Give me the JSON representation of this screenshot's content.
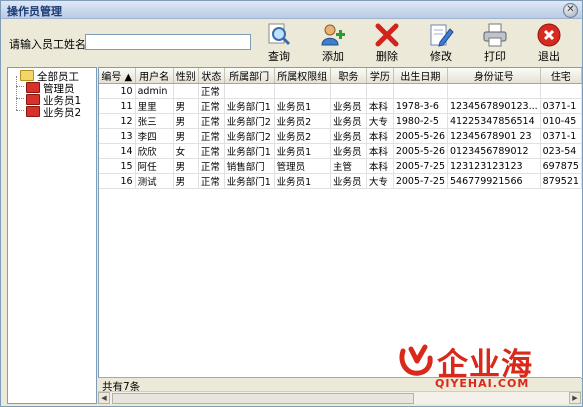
{
  "window": {
    "title": "操作员管理",
    "close_glyph": "✕"
  },
  "search": {
    "label": "请输入员工姓名：",
    "value": "",
    "placeholder": ""
  },
  "toolbar": [
    {
      "label": "查询",
      "icon": "search-icon"
    },
    {
      "label": "添加",
      "icon": "add-user-icon"
    },
    {
      "label": "删除",
      "icon": "delete-icon"
    },
    {
      "label": "修改",
      "icon": "edit-icon"
    },
    {
      "label": "打印",
      "icon": "printer-icon"
    },
    {
      "label": "退出",
      "icon": "exit-icon"
    }
  ],
  "tree": {
    "items": [
      {
        "label": "全部员工",
        "icon": "folder-open-icon",
        "color": "#f0d060"
      },
      {
        "label": "管理员",
        "icon": "folder-icon",
        "color": "#d8302a"
      },
      {
        "label": "业务员1",
        "icon": "folder-icon",
        "color": "#d8302a"
      },
      {
        "label": "业务员2",
        "icon": "folder-icon",
        "color": "#d8302a"
      }
    ]
  },
  "table": {
    "columns": [
      "编号 ▲",
      "用户名",
      "性别",
      "状态",
      "所属部门",
      "所属权限组",
      "职务",
      "学历",
      "出生日期",
      "身份证号",
      "住宅"
    ],
    "rows": [
      [
        "10",
        "admin",
        "",
        "正常",
        "",
        "",
        "",
        "",
        "",
        "",
        ""
      ],
      [
        "11",
        "里里",
        "男",
        "正常",
        "业务部门1",
        "业务员1",
        "业务员",
        "本科",
        "1978-3-6",
        "1234567890123...",
        "0371-1"
      ],
      [
        "12",
        "张三",
        "男",
        "正常",
        "业务部门2",
        "业务员2",
        "业务员",
        "大专",
        "1980-2-5",
        "41225347856514",
        "010-45"
      ],
      [
        "13",
        "李四",
        "男",
        "正常",
        "业务部门2",
        "业务员2",
        "业务员",
        "本科",
        "2005-5-26",
        "12345678901 23",
        "0371-1"
      ],
      [
        "14",
        "欣欣",
        "女",
        "正常",
        "业务部门1",
        "业务员1",
        "业务员",
        "本科",
        "2005-5-26",
        "0123456789012",
        "023-54"
      ],
      [
        "15",
        "阿任",
        "男",
        "正常",
        "销售部门",
        "管理员",
        "主管",
        "本科",
        "2005-7-25",
        "123123123123",
        "697875"
      ],
      [
        "16",
        "测试",
        "男",
        "正常",
        "业务部门1",
        "业务员1",
        "业务员",
        "大专",
        "2005-7-25",
        "546779921566",
        "879521"
      ]
    ]
  },
  "status": {
    "text": "共有7条"
  },
  "brand": {
    "name": "企业海",
    "url": "QIYEHAI.COM"
  }
}
